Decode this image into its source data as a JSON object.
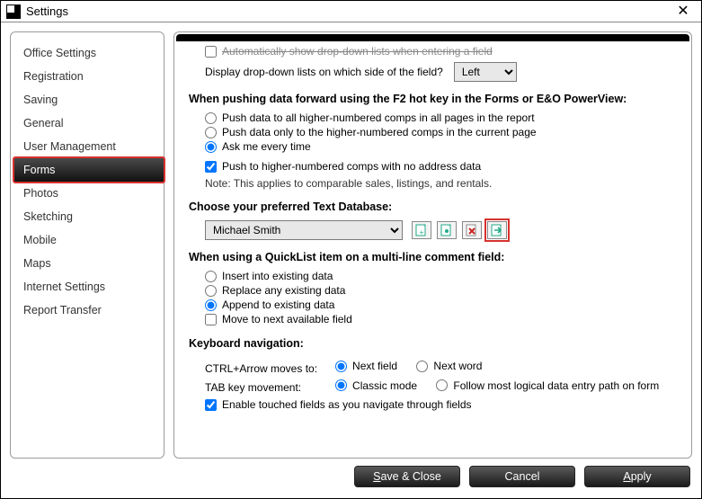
{
  "titlebar": {
    "title": "Settings",
    "close": "✕"
  },
  "sidebar": {
    "items": [
      {
        "label": "Office Settings"
      },
      {
        "label": "Registration"
      },
      {
        "label": "Saving"
      },
      {
        "label": "General"
      },
      {
        "label": "User Management"
      },
      {
        "label": "Forms",
        "selected": true
      },
      {
        "label": "Photos"
      },
      {
        "label": "Sketching"
      },
      {
        "label": "Mobile"
      },
      {
        "label": "Maps"
      },
      {
        "label": "Internet Settings"
      },
      {
        "label": "Report Transfer"
      }
    ]
  },
  "content": {
    "truncated_checkbox_label": "Automatically show drop-down lists when entering a field",
    "dropdown_side_label": "Display drop-down lists on which side of the field?",
    "dropdown_side_value": "Left",
    "push_section_title": "When pushing data forward using the F2 hot key in the Forms or E&O PowerView:",
    "push_options": {
      "all": "Push data to all higher-numbered comps in all pages in the report",
      "current": "Push data only to the higher-numbered comps in the current page",
      "ask": "Ask me every time"
    },
    "push_selected": "ask",
    "push_no_address_label": "Push to higher-numbered comps with no address data",
    "push_note": "Note: This applies to comparable sales, listings, and rentals.",
    "db_section_title": "Choose your preferred Text Database:",
    "db_value": "Michael Smith",
    "db_icons": {
      "add": "add-db",
      "new": "new-db",
      "delete": "delete-db",
      "migrate": "migrate-db"
    },
    "quicklist_title": "When using a QuickList item on a multi-line comment field:",
    "quicklist_options": {
      "insert": "Insert into existing data",
      "replace": "Replace any existing data",
      "append": "Append to existing data"
    },
    "quicklist_selected": "append",
    "quicklist_move_label": "Move to next available field",
    "keynav_title": "Keyboard navigation:",
    "ctrl_arrow_label": "CTRL+Arrow moves to:",
    "ctrl_arrow_options": {
      "field": "Next field",
      "word": "Next word"
    },
    "ctrl_arrow_selected": "field",
    "tab_label": "TAB key movement:",
    "tab_options": {
      "classic": "Classic mode",
      "logical": "Follow most logical data entry path on form"
    },
    "tab_selected": "classic",
    "touched_label": "Enable touched fields as you navigate through fields"
  },
  "footer": {
    "save": {
      "pre": "",
      "ul": "S",
      "post": "ave & Close"
    },
    "cancel": "Cancel",
    "apply": {
      "pre": "",
      "ul": "A",
      "post": "pply"
    }
  }
}
